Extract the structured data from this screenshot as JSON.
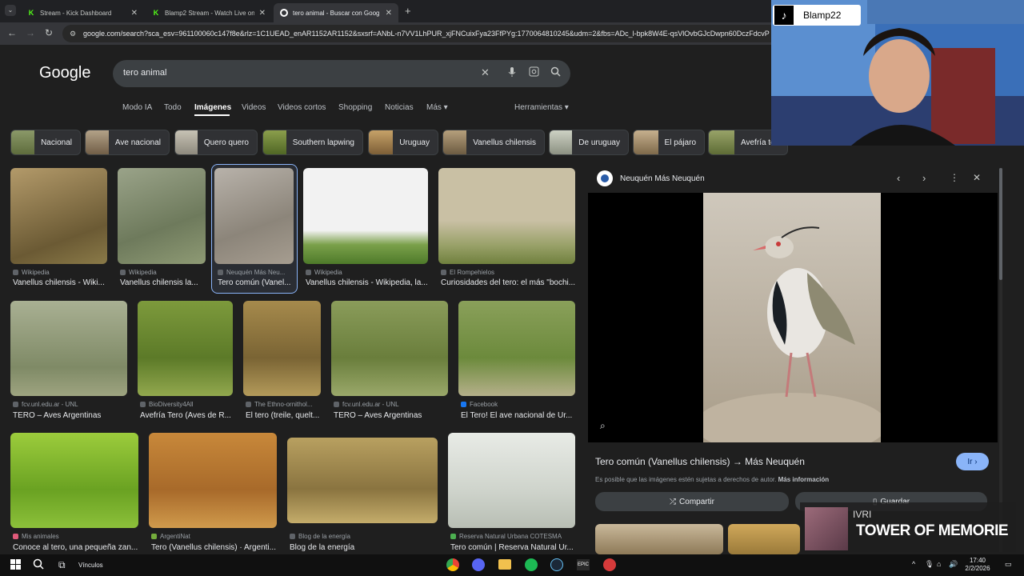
{
  "browser": {
    "tabs": [
      {
        "title": "Stream - Kick Dashboard",
        "favicon": "kick"
      },
      {
        "title": "Blamp2 Stream - Watch Live on",
        "favicon": "kick"
      },
      {
        "title": "tero animal - Buscar con Goog",
        "favicon": "google",
        "active": true
      }
    ],
    "new_tab": "+",
    "url": "google.com/search?sca_esv=961100060c147f8e&rlz=1C1UEAD_enAR1152AR1152&sxsrf=ANbL-n7VV1LhPUR_xjFNCuixFya23FfPYg:1770064810245&udm=2&fbs=ADc_l-bpk8W4E-qsVlOvbGJcDwpn60DczFdcvP"
  },
  "google": {
    "logo": "Google",
    "query": "tero animal",
    "nav_tabs": [
      "Modo IA",
      "Todo",
      "Imágenes",
      "Videos",
      "Videos cortos",
      "Shopping",
      "Noticias",
      "Más ▾"
    ],
    "tools": "Herramientas ▾",
    "chips": [
      "Nacional",
      "Ave nacional",
      "Quero quero",
      "Southern lapwing",
      "Uruguay",
      "Vanellus chilensis",
      "De uruguay",
      "El pájaro",
      "Avefría te"
    ],
    "results": [
      {
        "source": "Wikipedia",
        "title": "Vanellus chilensis - Wiki..."
      },
      {
        "source": "Wikipedia",
        "title": "Vanellus chilensis la..."
      },
      {
        "source": "Neuquén Más Neu...",
        "title": "Tero común (Vanel..."
      },
      {
        "source": "Wikipedia",
        "title": "Vanellus chilensis - Wikipedia, la..."
      },
      {
        "source": "El Rompehielos",
        "title": "Curiosidades del tero: el más \"bochi..."
      },
      {
        "source": "fcv.unl.edu.ar - UNL",
        "title": "TERO – Aves Argentinas"
      },
      {
        "source": "BioDiversity4All",
        "title": "Avefría Tero (Aves de R..."
      },
      {
        "source": "The Ethno-ornithol...",
        "title": "El tero (treile, quelt..."
      },
      {
        "source": "fcv.unl.edu.ar - UNL",
        "title": "TERO – Aves Argentinas"
      },
      {
        "source": "Facebook",
        "title": "El Tero! El ave nacional de Ur..."
      },
      {
        "source": "Mis animales",
        "title": "Conoce al tero, una pequeña zan..."
      },
      {
        "source": "ArgentiNat",
        "title": "Tero (Vanellus chilensis) · Argenti..."
      },
      {
        "source": "Blog de la energía",
        "title": "Blog de la energía"
      },
      {
        "source": "Reserva Natural Urbana COTESMA",
        "title": "Tero común | Reserva Natural Ur..."
      }
    ],
    "preview": {
      "source": "Neuquén Más Neuquén",
      "title": "Tero común (Vanellus chilensis) → Más Neuquén",
      "go": "Ir ›",
      "copyright": "Es posible que las imágenes estén sujetas a derechos de autor.",
      "more_info": "Más información",
      "share": "Compartir",
      "save": "Guardar"
    }
  },
  "overlay": {
    "tiktok_user": "Blamp22",
    "music_artist": "IVRI",
    "music_song": "TOWER OF MEMORIE"
  },
  "taskbar": {
    "search_label": "Vínculos",
    "time": "17:40",
    "date": "2/2/2026"
  },
  "colors": {
    "accent": "#8ab4f8",
    "kick": "#53fc18"
  }
}
